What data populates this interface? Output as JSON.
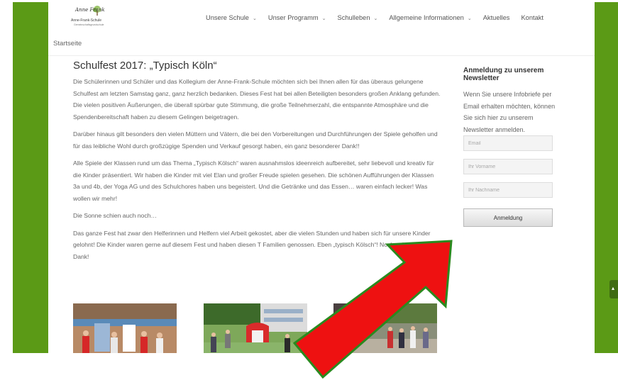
{
  "logo": {
    "script_text": "Anne Frank",
    "name": "Anne-Frank-Schule",
    "tagline": "Gemeinschaftsgrundschule"
  },
  "nav": {
    "items": [
      {
        "label": "Unsere Schule",
        "has_dropdown": true
      },
      {
        "label": "Unser Programm",
        "has_dropdown": true
      },
      {
        "label": "Schulleben",
        "has_dropdown": true
      },
      {
        "label": "Allgemeine Informationen",
        "has_dropdown": true
      },
      {
        "label": "Aktuelles",
        "has_dropdown": false
      },
      {
        "label": "Kontakt",
        "has_dropdown": false
      }
    ],
    "chevron_icon": "chevron-down-icon"
  },
  "breadcrumb": "Startseite",
  "article": {
    "title": "Schulfest 2017: „Typisch Köln“",
    "paragraphs": [
      "Die Schülerinnen und Schüler und das Kollegium der Anne-Frank-Schule möchten sich bei Ihnen allen für das überaus gelungene Schulfest am letzten Samstag ganz, ganz herzlich bedanken. Dieses Fest hat bei allen Beteiligten besonders großen Anklang gefunden. Die vielen positiven Äußerungen, die überall spürbar gute Stimmung, die große Teilnehmerzahl, die entspannte Atmosphäre und die Spendenbereitschaft haben zu diesem Gelingen beigetragen.",
      "Darüber hinaus gilt besonders den vielen Müttern und Vätern, die bei den Vorbereitungen und Durchführungen der Spiele geholfen und für das leibliche Wohl durch großzügige Spenden und Verkauf gesorgt haben, ein ganz besonderer Dank!!",
      "Alle Spiele der Klassen rund um das Thema „Typisch Kölsch“ waren ausnahmslos ideenreich aufbereitet, sehr liebevoll und kreativ für die Kinder präsentiert. Wir haben die Kinder mit viel Elan und großer Freude spielen gesehen. Die schönen Aufführungen der Klassen 3a und 4b, der Yoga AG und des Schulchores haben uns begeistert. Und die Getränke und das Essen… waren einfach lecker! Was wollen wir mehr!",
      "Die Sonne schien auch noch…",
      "Das ganze Fest hat zwar den Helferinnen und Helfern viel Arbeit gekostet, aber die vielen Stunden und haben sich für unsere Kinder gelohnt! Die Kinder waren gerne auf diesem Fest und haben diesen T Familien genossen. Eben „typisch Kölsch“! Nochmals herzlichen Dank!"
    ]
  },
  "gallery": {
    "images": [
      "photo-stage-performance",
      "photo-schoolyard-bouncy-castle",
      "photo-crowd-yard"
    ]
  },
  "newsletter": {
    "title": "Anmeldung zu unserem Newsletter",
    "text": "Wenn Sie unsere Infobriefe per Email erhalten möchten, können Sie sich hier zu unserem Newsletter anmelden.",
    "email_placeholder": "Email",
    "firstname_placeholder": "Ihr Vorname",
    "lastname_placeholder": "Ihr Nachname",
    "button_label": "Anmeldung"
  },
  "colors": {
    "frame_green": "#5b9a16",
    "arrow_red": "#ee1111",
    "arrow_green_outline": "#2a8a1f"
  }
}
